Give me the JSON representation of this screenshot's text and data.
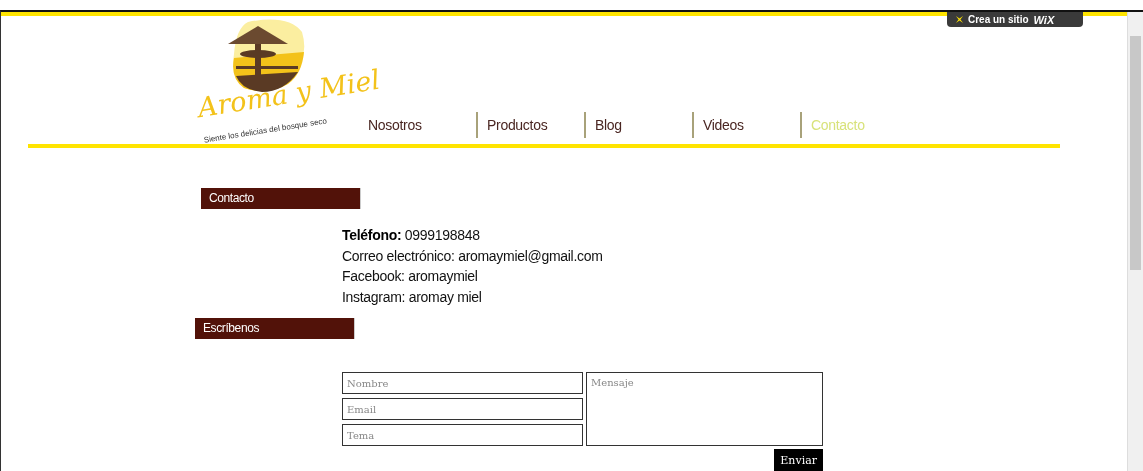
{
  "promo_badge": {
    "label": "Crea un sitio",
    "brand": "WiX"
  },
  "logo": {
    "name": "Aroma y Miel",
    "tagline": "Siente los delicias del bosque seco"
  },
  "nav": [
    {
      "label": "Nosotros",
      "selected": false
    },
    {
      "label": "Productos",
      "selected": false
    },
    {
      "label": "Blog",
      "selected": false
    },
    {
      "label": "Videos",
      "selected": false
    },
    {
      "label": "Contacto",
      "selected": true
    }
  ],
  "contact_section": {
    "heading": "Contacto",
    "lines": [
      "**Teléfono:** 0999198848",
      "Correo electrónico: aromaymiel@gmail.com",
      "Facebook: aromaymiel",
      "Instagram: aromay miel"
    ]
  },
  "form_section": {
    "heading": "Escríbenos",
    "fields": [
      {
        "placeholder": "Nombre"
      },
      {
        "placeholder": "Email"
      },
      {
        "placeholder": "Tema"
      }
    ],
    "message": {
      "placeholder": "Mensaje"
    },
    "submit": "Enviar"
  }
}
